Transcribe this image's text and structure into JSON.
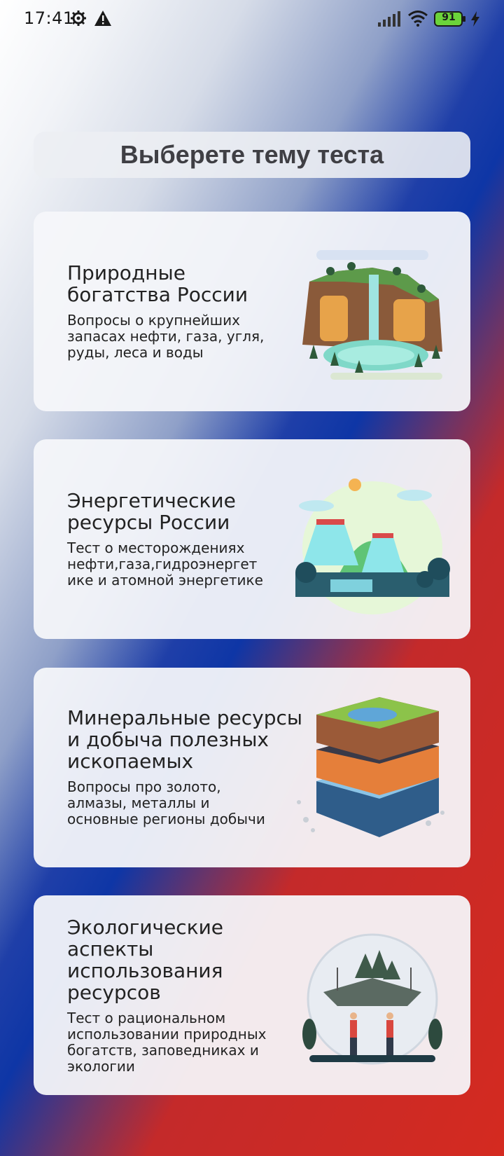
{
  "status_bar": {
    "time": "17:41",
    "battery": "91",
    "icons": [
      "gear-icon",
      "warning-icon",
      "signal-icon",
      "wifi-icon",
      "battery-icon",
      "charging-icon"
    ]
  },
  "header": {
    "title": "Выберете тему теста"
  },
  "topics": [
    {
      "title_lines": [
        "Природные",
        "богатства России"
      ],
      "description_lines": [
        "Вопросы о крупнейших",
        "запасах нефти, газа, угля,",
        "руды, леса и воды"
      ]
    },
    {
      "title_lines": [
        "Энергетические",
        "ресурсы России"
      ],
      "description_lines": [
        "Тест о месторождениях",
        "нефти,газа,гидроэнергет",
        "ике и атомной энергетике"
      ]
    },
    {
      "title_lines": [
        "Минеральные ресурсы",
        "и добыча полезных",
        "ископаемых"
      ],
      "description_lines": [
        "Вопросы про золото,",
        "алмазы, металлы и",
        "основные регионы добычи"
      ]
    },
    {
      "title_lines": [
        "Экологические",
        "аспекты",
        "использования",
        "ресурсов"
      ],
      "description_lines": [
        "Тест о рациональном",
        "использовании природных",
        "богатств, заповедниках и",
        "экологии"
      ]
    }
  ],
  "colors": {
    "flag_white": "#ffffff",
    "flag_blue": "#0e36a6",
    "flag_red": "#d42a20",
    "card_bg": "#f5f6fa",
    "title_text": "#3f3f44"
  }
}
